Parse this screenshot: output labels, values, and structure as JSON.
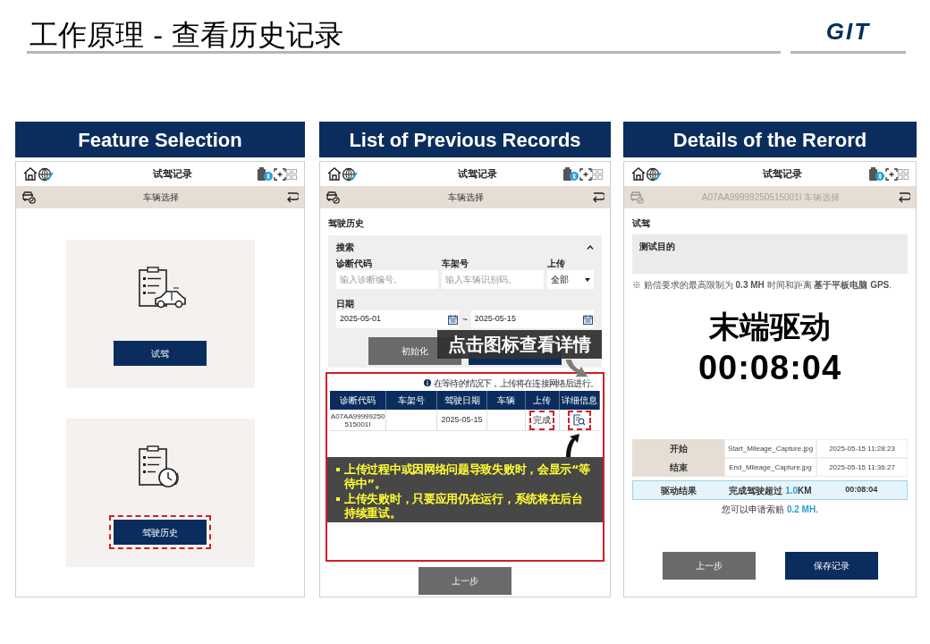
{
  "slide_title": "工作原理 - 查看历史记录",
  "logo": "GIT",
  "panels": [
    {
      "kind": "feature_selection",
      "heading": "Feature Selection",
      "app_title": "试驾记录",
      "vehicle_bar": "车辆选择",
      "cards": [
        {
          "kind": "test_drive",
          "button": "试驾",
          "highlighted": false
        },
        {
          "kind": "history",
          "button": "驾驶历史",
          "highlighted": true
        }
      ]
    },
    {
      "kind": "record_list",
      "heading": "List of Previous Records",
      "app_title": "试驾记录",
      "vehicle_bar": "车辆选择",
      "section_title": "驾驶历史",
      "search": {
        "title": "搜索",
        "expanded": true,
        "fields": [
          {
            "label": "诊断代码",
            "placeholder": "输入诊断编号。"
          },
          {
            "label": "车架号",
            "placeholder": "输入车辆识别码。"
          }
        ],
        "upload": {
          "label": "上传",
          "value": "全部"
        },
        "date": {
          "label": "日期",
          "from": "2025-05-01",
          "separator": "~",
          "to": "2025-05-15"
        },
        "buttons": [
          {
            "kind": "reset",
            "label": "初始化"
          },
          {
            "kind": "search"
          }
        ]
      },
      "callout": "点击图标查看详情",
      "info": "在等待的情况下，上传将在连接网络后进行。",
      "table": {
        "columns": [
          "诊断代码",
          "车架号",
          "驾驶日期",
          "车辆",
          "上传",
          "详细信息"
        ],
        "rows": [
          {
            "code": "A07AA99999250515001I",
            "date": "2025-05-15",
            "upload": "完成",
            "highlighted": true
          }
        ]
      },
      "notes": [
        "上传过程中或因网络问题导致失败时，会显示“等待中”。",
        "上传失败时，只要应用仍在运行，系统将在后台持续重试。"
      ],
      "back_button": "上一步"
    },
    {
      "kind": "record_detail",
      "heading": "Details of the Rerord",
      "app_title": "试驾记录",
      "vehicle_bar": "A07AA99999250515001I 车辆选择",
      "section_title": "试驾",
      "purpose_label": "测试目的",
      "note": "※ 赔偿要求的最高限制为 **0.3 MH** 时间和距离 **基于平板电脑 GPS**.",
      "status": "末端驱动",
      "timer": "00:08:04",
      "captures": [
        {
          "label": "开始",
          "file": "Start_Mileage_Capture.jpg",
          "time": "2025-05-15 11:28:23"
        },
        {
          "label": "结束",
          "file": "End_Mileage_Capture.jpg",
          "time": "2025-05-15 11:36:27"
        }
      ],
      "result": {
        "label": "驱动结果",
        "prefix": "完成驾驶超过 ",
        "distance": "1.0",
        "unit": "KM",
        "duration": "00:08:04"
      },
      "claim": {
        "prefix": "您可以申请索赔 ",
        "amount": "0.2 MH",
        "suffix": "."
      },
      "buttons": [
        {
          "kind": "back",
          "label": "上一步"
        },
        {
          "kind": "save",
          "label": "保存记录"
        }
      ]
    }
  ]
}
